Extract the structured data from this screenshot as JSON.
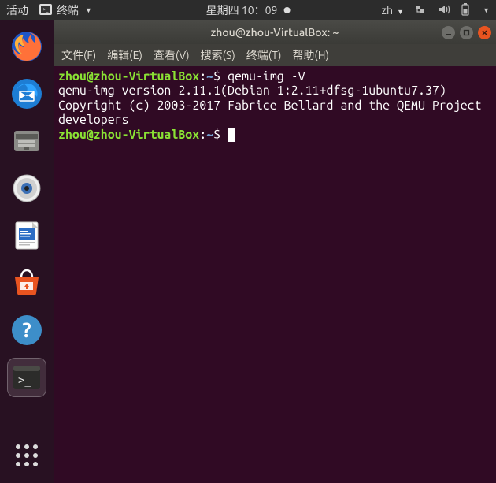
{
  "top": {
    "activities": "活动",
    "app_name": "终端",
    "datetime": "星期四 10：09",
    "input_method": "zh",
    "icons": {
      "network": "network-icon",
      "sound": "sound-icon",
      "battery": "battery-icon",
      "power": "power-icon"
    }
  },
  "launcher": {
    "items": [
      "firefox",
      "thunderbird",
      "files",
      "rhythmbox",
      "libreoffice-writer",
      "ubuntu-software",
      "help",
      "terminal"
    ],
    "apps": "show-applications"
  },
  "window": {
    "title": "zhou@zhou-VirtualBox: ~",
    "menus": [
      "文件(F)",
      "编辑(E)",
      "查看(V)",
      "搜索(S)",
      "终端(T)",
      "帮助(H)"
    ]
  },
  "terminal": {
    "prompt_user": "zhou@zhou-VirtualBox",
    "prompt_sep": ":",
    "prompt_path": "~",
    "prompt_symbol": "$",
    "cmd1": "qemu-img -V",
    "out1": "qemu-img version 2.11.1(Debian 1:2.11+dfsg-1ubuntu7.37)",
    "out2": "Copyright (c) 2003-2017 Fabrice Bellard and the QEMU Project developers"
  }
}
